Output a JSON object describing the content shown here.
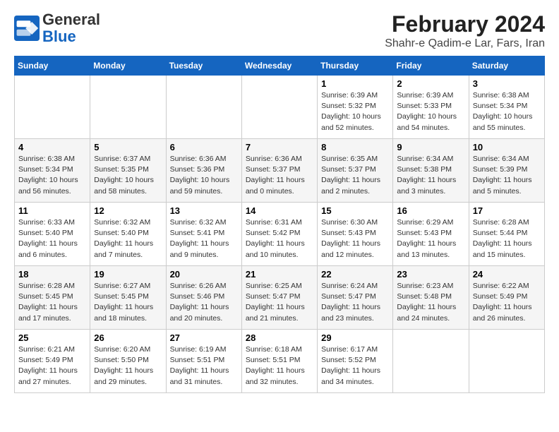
{
  "header": {
    "logo_general": "General",
    "logo_blue": "Blue",
    "title": "February 2024",
    "location": "Shahr-e Qadim-e Lar, Fars, Iran"
  },
  "days_of_week": [
    "Sunday",
    "Monday",
    "Tuesday",
    "Wednesday",
    "Thursday",
    "Friday",
    "Saturday"
  ],
  "weeks": [
    [
      {
        "day": "",
        "detail": ""
      },
      {
        "day": "",
        "detail": ""
      },
      {
        "day": "",
        "detail": ""
      },
      {
        "day": "",
        "detail": ""
      },
      {
        "day": "1",
        "detail": "Sunrise: 6:39 AM\nSunset: 5:32 PM\nDaylight: 10 hours\nand 52 minutes."
      },
      {
        "day": "2",
        "detail": "Sunrise: 6:39 AM\nSunset: 5:33 PM\nDaylight: 10 hours\nand 54 minutes."
      },
      {
        "day": "3",
        "detail": "Sunrise: 6:38 AM\nSunset: 5:34 PM\nDaylight: 10 hours\nand 55 minutes."
      }
    ],
    [
      {
        "day": "4",
        "detail": "Sunrise: 6:38 AM\nSunset: 5:34 PM\nDaylight: 10 hours\nand 56 minutes."
      },
      {
        "day": "5",
        "detail": "Sunrise: 6:37 AM\nSunset: 5:35 PM\nDaylight: 10 hours\nand 58 minutes."
      },
      {
        "day": "6",
        "detail": "Sunrise: 6:36 AM\nSunset: 5:36 PM\nDaylight: 10 hours\nand 59 minutes."
      },
      {
        "day": "7",
        "detail": "Sunrise: 6:36 AM\nSunset: 5:37 PM\nDaylight: 11 hours\nand 0 minutes."
      },
      {
        "day": "8",
        "detail": "Sunrise: 6:35 AM\nSunset: 5:37 PM\nDaylight: 11 hours\nand 2 minutes."
      },
      {
        "day": "9",
        "detail": "Sunrise: 6:34 AM\nSunset: 5:38 PM\nDaylight: 11 hours\nand 3 minutes."
      },
      {
        "day": "10",
        "detail": "Sunrise: 6:34 AM\nSunset: 5:39 PM\nDaylight: 11 hours\nand 5 minutes."
      }
    ],
    [
      {
        "day": "11",
        "detail": "Sunrise: 6:33 AM\nSunset: 5:40 PM\nDaylight: 11 hours\nand 6 minutes."
      },
      {
        "day": "12",
        "detail": "Sunrise: 6:32 AM\nSunset: 5:40 PM\nDaylight: 11 hours\nand 7 minutes."
      },
      {
        "day": "13",
        "detail": "Sunrise: 6:32 AM\nSunset: 5:41 PM\nDaylight: 11 hours\nand 9 minutes."
      },
      {
        "day": "14",
        "detail": "Sunrise: 6:31 AM\nSunset: 5:42 PM\nDaylight: 11 hours\nand 10 minutes."
      },
      {
        "day": "15",
        "detail": "Sunrise: 6:30 AM\nSunset: 5:43 PM\nDaylight: 11 hours\nand 12 minutes."
      },
      {
        "day": "16",
        "detail": "Sunrise: 6:29 AM\nSunset: 5:43 PM\nDaylight: 11 hours\nand 13 minutes."
      },
      {
        "day": "17",
        "detail": "Sunrise: 6:28 AM\nSunset: 5:44 PM\nDaylight: 11 hours\nand 15 minutes."
      }
    ],
    [
      {
        "day": "18",
        "detail": "Sunrise: 6:28 AM\nSunset: 5:45 PM\nDaylight: 11 hours\nand 17 minutes."
      },
      {
        "day": "19",
        "detail": "Sunrise: 6:27 AM\nSunset: 5:45 PM\nDaylight: 11 hours\nand 18 minutes."
      },
      {
        "day": "20",
        "detail": "Sunrise: 6:26 AM\nSunset: 5:46 PM\nDaylight: 11 hours\nand 20 minutes."
      },
      {
        "day": "21",
        "detail": "Sunrise: 6:25 AM\nSunset: 5:47 PM\nDaylight: 11 hours\nand 21 minutes."
      },
      {
        "day": "22",
        "detail": "Sunrise: 6:24 AM\nSunset: 5:47 PM\nDaylight: 11 hours\nand 23 minutes."
      },
      {
        "day": "23",
        "detail": "Sunrise: 6:23 AM\nSunset: 5:48 PM\nDaylight: 11 hours\nand 24 minutes."
      },
      {
        "day": "24",
        "detail": "Sunrise: 6:22 AM\nSunset: 5:49 PM\nDaylight: 11 hours\nand 26 minutes."
      }
    ],
    [
      {
        "day": "25",
        "detail": "Sunrise: 6:21 AM\nSunset: 5:49 PM\nDaylight: 11 hours\nand 27 minutes."
      },
      {
        "day": "26",
        "detail": "Sunrise: 6:20 AM\nSunset: 5:50 PM\nDaylight: 11 hours\nand 29 minutes."
      },
      {
        "day": "27",
        "detail": "Sunrise: 6:19 AM\nSunset: 5:51 PM\nDaylight: 11 hours\nand 31 minutes."
      },
      {
        "day": "28",
        "detail": "Sunrise: 6:18 AM\nSunset: 5:51 PM\nDaylight: 11 hours\nand 32 minutes."
      },
      {
        "day": "29",
        "detail": "Sunrise: 6:17 AM\nSunset: 5:52 PM\nDaylight: 11 hours\nand 34 minutes."
      },
      {
        "day": "",
        "detail": ""
      },
      {
        "day": "",
        "detail": ""
      }
    ]
  ]
}
